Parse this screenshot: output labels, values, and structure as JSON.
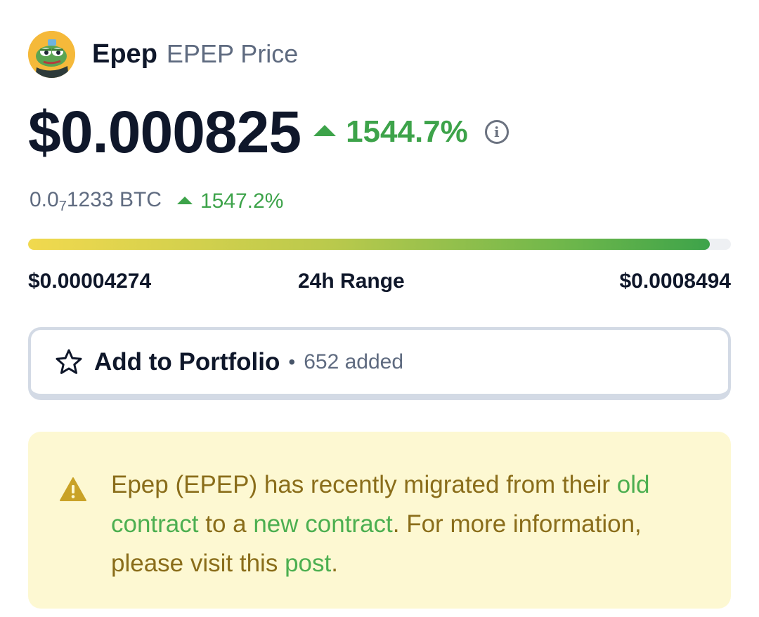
{
  "header": {
    "logo_icon": "pepe-frog-avatar",
    "coin_name": "Epep",
    "coin_subtitle": "EPEP Price"
  },
  "price": {
    "value": "$0.000825",
    "change_pct": "1544.7%",
    "change_direction": "up",
    "info_icon": "info-icon"
  },
  "btc": {
    "prefix": "0.0",
    "subscript": "7",
    "digits": "1233",
    "unit": "BTC",
    "change_pct": "1547.2%"
  },
  "range": {
    "low": "$0.00004274",
    "label": "24h Range",
    "high": "$0.0008494",
    "position_fraction": 0.97
  },
  "portfolio": {
    "icon": "star-icon",
    "label": "Add to Portfolio",
    "separator": "•",
    "count_text": "652 added"
  },
  "notice": {
    "icon": "warning-icon",
    "text_1": "Epep (EPEP) has recently migrated from their ",
    "link_old": "old contract",
    "text_2": " to a ",
    "link_new": "new contract",
    "text_3": ". For more information, please visit this ",
    "link_post": "post",
    "text_4": "."
  },
  "colors": {
    "positive": "#3da34a",
    "notice_bg": "#fdf8d2",
    "notice_text": "#8a6d1a",
    "link": "#4caf50"
  }
}
